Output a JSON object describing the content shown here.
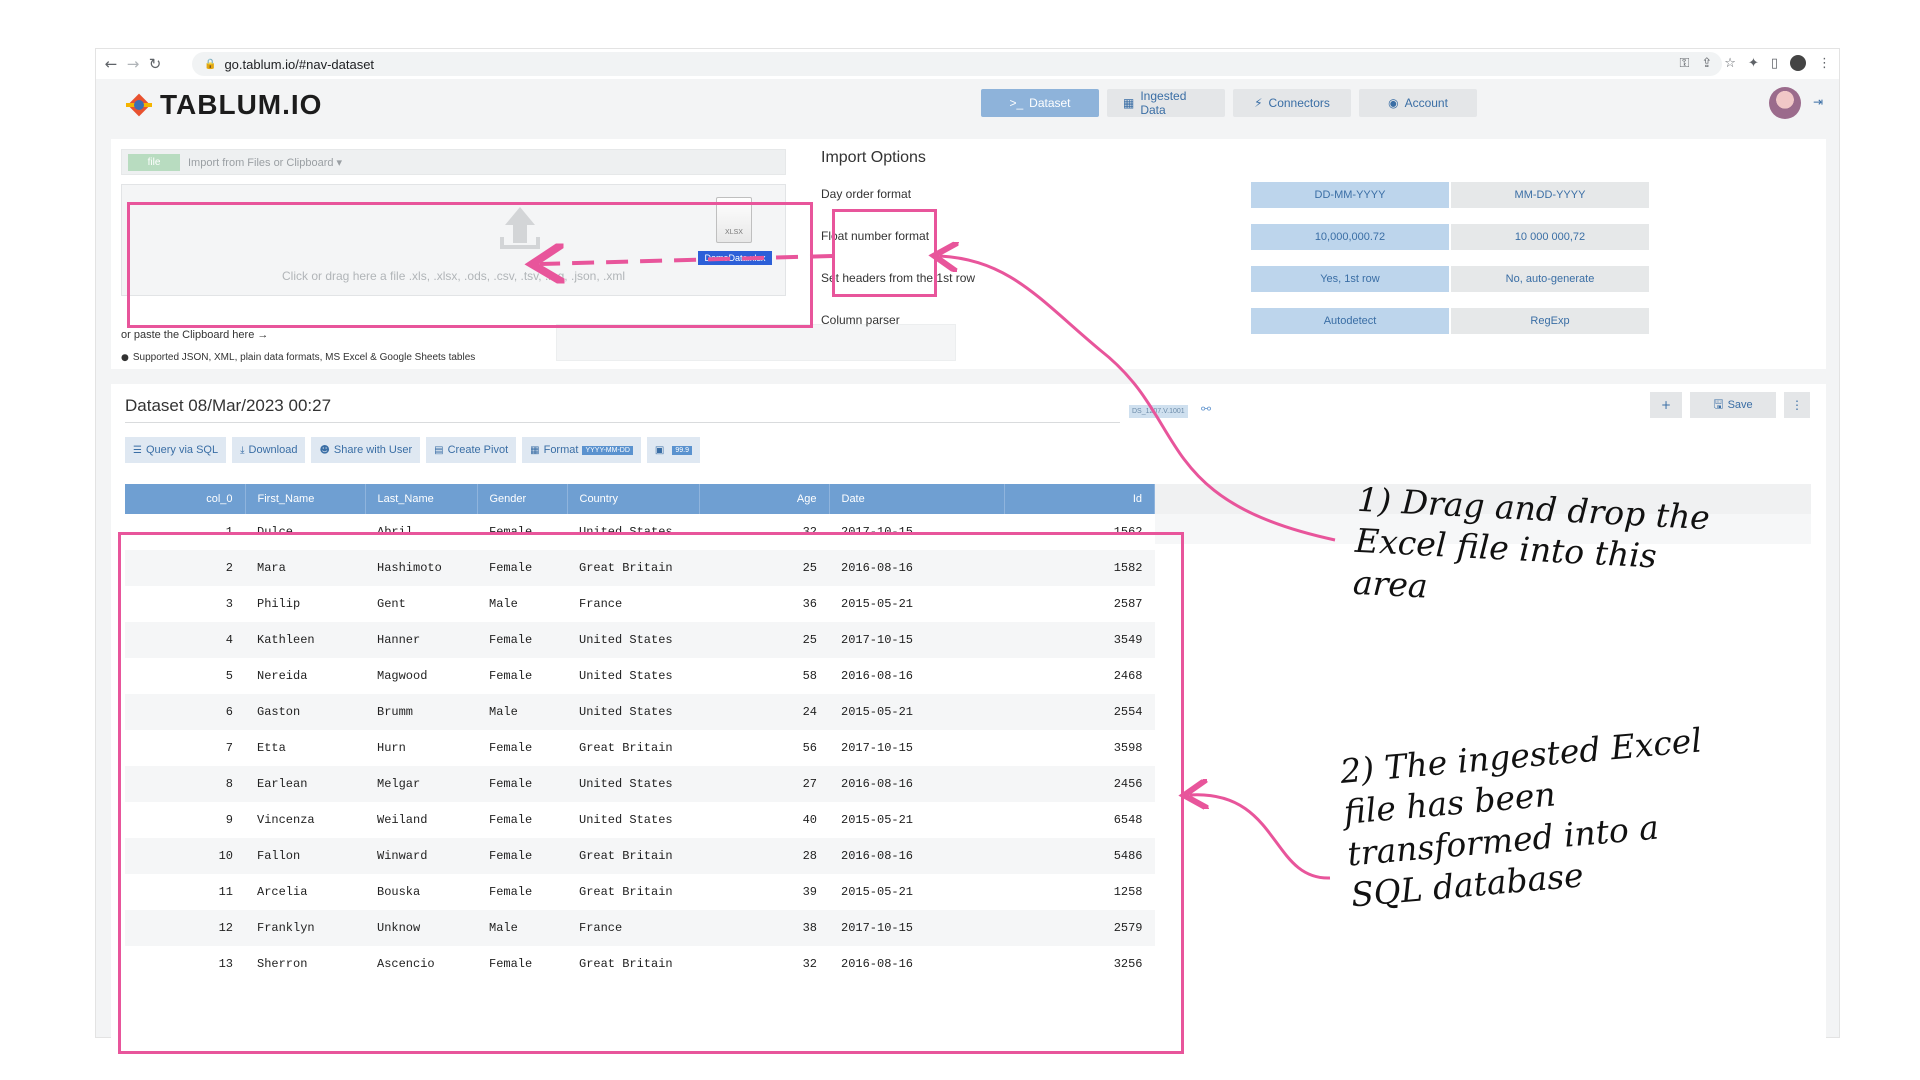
{
  "browser": {
    "url": "go.tablum.io/#nav-dataset",
    "back_icon": "arrow-left-icon",
    "forward_icon": "arrow-right-icon",
    "reload_icon": "reload-icon"
  },
  "app": {
    "logo_text": "TABLUM.IO",
    "nav": [
      {
        "label": "Dataset",
        "prefix": ">_",
        "active": true
      },
      {
        "label": "Ingested Data",
        "icon": "table-icon"
      },
      {
        "label": "Connectors",
        "icon": "plug-icon"
      },
      {
        "label": "Account",
        "icon": "user-icon"
      }
    ]
  },
  "import": {
    "file_button": "file",
    "import_from": "Import from Files or Clipboard",
    "drop_hint": "Click or drag here a file .xls, .xlsx, .ods, .csv, .tsv, .log, .json, .xml",
    "file_type": "XLSX",
    "file_name": "DemoData.xlsx",
    "paste_label": "or paste the Clipboard here →",
    "supported_note": "Supported JSON, XML, plain data formats, MS Excel & Google Sheets tables"
  },
  "import_options": {
    "title": "Import Options",
    "rows": [
      {
        "label": "Day order format",
        "on": "DD-MM-YYYY",
        "off": "MM-DD-YYYY"
      },
      {
        "label": "Float number format",
        "on": "10,000,000.72",
        "off": "10 000 000,72"
      },
      {
        "label": "Set headers from the 1st row",
        "on": "Yes, 1st row",
        "off": "No, auto-generate"
      },
      {
        "label": "Column parser",
        "on": "Autodetect",
        "off": "RegExp"
      }
    ]
  },
  "dataset": {
    "title": "Dataset 08/Mar/2023 00:27",
    "id_badge": "DS_1207.V.1001",
    "save_label": "Save",
    "toolbar": {
      "query": "Query via SQL",
      "download": "Download",
      "share": "Share with User",
      "pivot": "Create Pivot",
      "format": "Format",
      "format_chip": "YYYY-MM-DD",
      "number_chip": "99.9"
    },
    "columns": [
      "col_0",
      "First_Name",
      "Last_Name",
      "Gender",
      "Country",
      "Age",
      "Date",
      "Id"
    ],
    "rows": [
      [
        "1",
        "Dulce",
        "Abril",
        "Female",
        "United States",
        "32",
        "2017-10-15",
        "1562"
      ],
      [
        "2",
        "Mara",
        "Hashimoto",
        "Female",
        "Great Britain",
        "25",
        "2016-08-16",
        "1582"
      ],
      [
        "3",
        "Philip",
        "Gent",
        "Male",
        "France",
        "36",
        "2015-05-21",
        "2587"
      ],
      [
        "4",
        "Kathleen",
        "Hanner",
        "Female",
        "United States",
        "25",
        "2017-10-15",
        "3549"
      ],
      [
        "5",
        "Nereida",
        "Magwood",
        "Female",
        "United States",
        "58",
        "2016-08-16",
        "2468"
      ],
      [
        "6",
        "Gaston",
        "Brumm",
        "Male",
        "United States",
        "24",
        "2015-05-21",
        "2554"
      ],
      [
        "7",
        "Etta",
        "Hurn",
        "Female",
        "Great Britain",
        "56",
        "2017-10-15",
        "3598"
      ],
      [
        "8",
        "Earlean",
        "Melgar",
        "Female",
        "United States",
        "27",
        "2016-08-16",
        "2456"
      ],
      [
        "9",
        "Vincenza",
        "Weiland",
        "Female",
        "United States",
        "40",
        "2015-05-21",
        "6548"
      ],
      [
        "10",
        "Fallon",
        "Winward",
        "Female",
        "Great Britain",
        "28",
        "2016-08-16",
        "5486"
      ],
      [
        "11",
        "Arcelia",
        "Bouska",
        "Female",
        "Great Britain",
        "39",
        "2015-05-21",
        "1258"
      ],
      [
        "12",
        "Franklyn",
        "Unknow",
        "Male",
        "France",
        "38",
        "2017-10-15",
        "2579"
      ],
      [
        "13",
        "Sherron",
        "Ascencio",
        "Female",
        "Great Britain",
        "32",
        "2016-08-16",
        "3256"
      ]
    ]
  },
  "annotations": {
    "first": [
      "1) Drag and drop the",
      "Excel file into this",
      "area"
    ],
    "second": [
      "2) The ingested Excel",
      "file has been",
      "transformed into a",
      "SQL database"
    ]
  },
  "colors": {
    "highlight": "#e8559b",
    "accent": "#3a6ea5",
    "header": "#6f9fd2"
  }
}
